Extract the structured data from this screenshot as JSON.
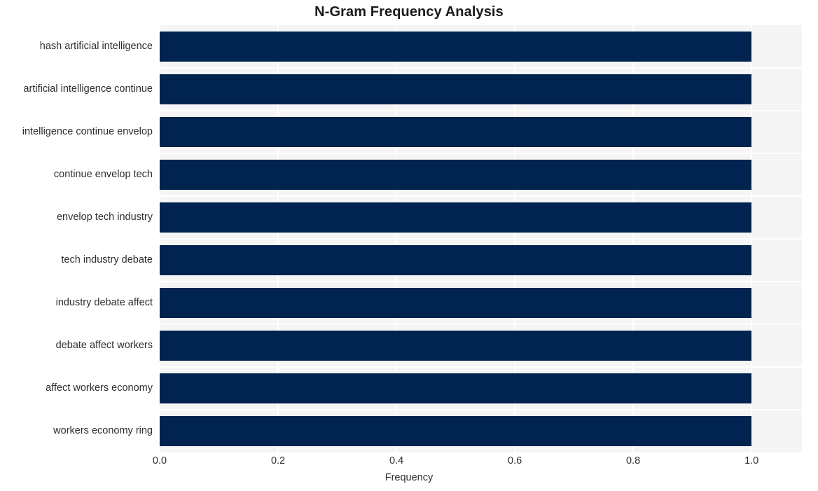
{
  "chart_data": {
    "type": "bar",
    "orientation": "horizontal",
    "title": "N-Gram Frequency Analysis",
    "xlabel": "Frequency",
    "ylabel": "",
    "categories": [
      "hash artificial intelligence",
      "artificial intelligence continue",
      "intelligence continue envelop",
      "continue envelop tech",
      "envelop tech industry",
      "tech industry debate",
      "industry debate affect",
      "debate affect workers",
      "affect workers economy",
      "workers economy ring"
    ],
    "values": [
      1.0,
      1.0,
      1.0,
      1.0,
      1.0,
      1.0,
      1.0,
      1.0,
      1.0,
      1.0
    ],
    "xticks": [
      "0.0",
      "0.2",
      "0.4",
      "0.6",
      "0.8",
      "1.0"
    ],
    "xtick_values": [
      0.0,
      0.2,
      0.4,
      0.6,
      0.8,
      1.0
    ],
    "xlim": [
      0.0,
      1.085
    ],
    "grid": true,
    "legend": null,
    "bar_color": "#00234f",
    "plot_background": "#f5f5f6",
    "grid_color": "#ffffff",
    "page_background": "#ffffff"
  }
}
